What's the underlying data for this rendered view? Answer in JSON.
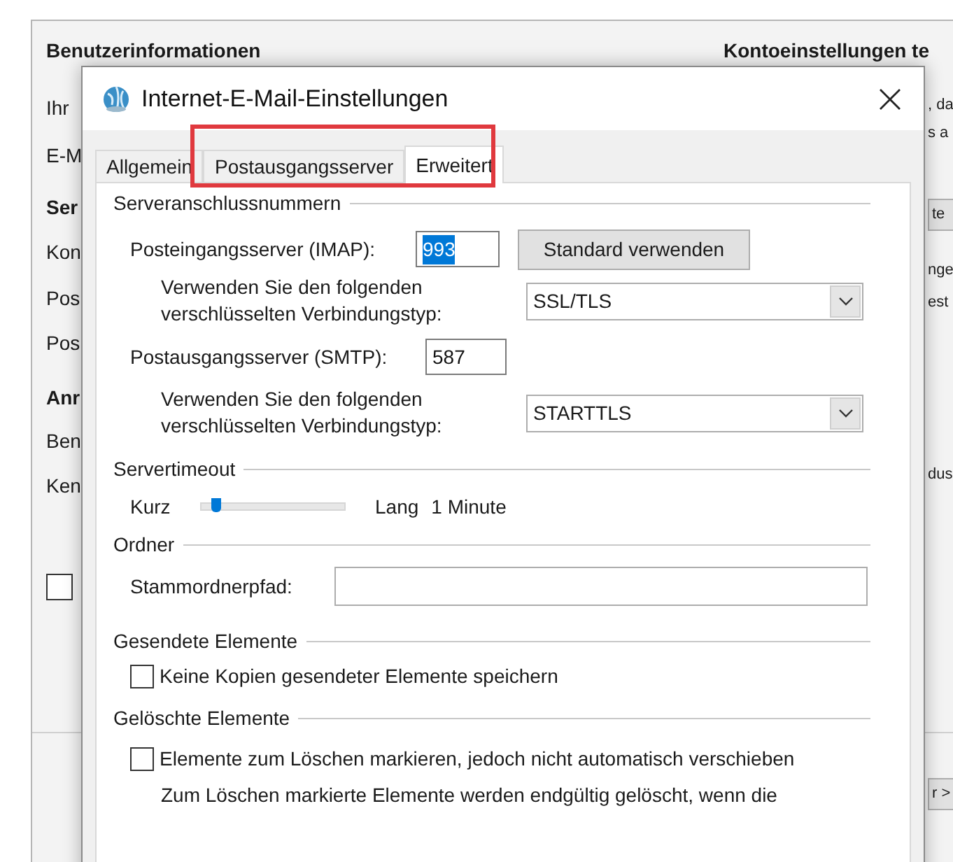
{
  "background_window": {
    "left_heading": "Benutzerinformationen",
    "right_heading": "Kontoeinstellungen te",
    "left_fragments": [
      {
        "text": "Ihr",
        "bold": false
      },
      {
        "text": "E-M",
        "bold": false
      },
      {
        "text": "Ser",
        "bold": true
      },
      {
        "text": "Kon",
        "bold": false
      },
      {
        "text": "Pos",
        "bold": false
      },
      {
        "text": "Pos",
        "bold": false
      },
      {
        "text": "Anr",
        "bold": true
      },
      {
        "text": "Ben",
        "bold": false
      },
      {
        "text": "Ken",
        "bold": false
      }
    ],
    "left_checkbox": {
      "checked": false
    },
    "right_fragments": [
      {
        "text": ", da",
        "kind": "text"
      },
      {
        "text": "s a",
        "kind": "text"
      },
      {
        "text": "te",
        "kind": "button"
      },
      {
        "text": "nge",
        "kind": "text"
      },
      {
        "text": "est",
        "kind": "text"
      },
      {
        "text": "dus",
        "kind": "text"
      },
      {
        "text": "r >",
        "kind": "button"
      }
    ]
  },
  "dialog": {
    "title": "Internet-E-Mail-Einstellungen",
    "tabs": [
      {
        "label": "Allgemein",
        "selected": false,
        "highlighted": false
      },
      {
        "label": "Postausgangsserver",
        "selected": false,
        "highlighted": true
      },
      {
        "label": "Erweitert",
        "selected": true,
        "highlighted": true
      }
    ],
    "server_ports": {
      "heading": "Serveranschlussnummern",
      "incoming": {
        "label": "Posteingangsserver (IMAP):",
        "value": "993",
        "value_selected": true,
        "button": "Standard verwenden"
      },
      "incoming_encryption": {
        "label": "Verwenden Sie den folgenden verschlüsselten Verbindungstyp:",
        "value": "SSL/TLS"
      },
      "outgoing": {
        "label": "Postausgangsserver (SMTP):",
        "value": "587",
        "value_selected": false
      },
      "outgoing_encryption": {
        "label": "Verwenden Sie den folgenden verschlüsselten Verbindungstyp:",
        "value": "STARTTLS"
      }
    },
    "server_timeout": {
      "heading": "Servertimeout",
      "min_label": "Kurz",
      "max_label": "Lang",
      "level": 0.1,
      "reading": "1 Minute"
    },
    "folders": {
      "heading": "Ordner",
      "label": "Stammordnerpfad:"
    },
    "sent_items": {
      "heading": "Gesendete Elemente",
      "checkbox": {
        "label": "Keine Kopien gesendeter Elemente speichern",
        "checked": false
      }
    },
    "deleted_items": {
      "heading": "Gelöschte Elemente",
      "checkbox": {
        "label": "Elemente zum Löschen markieren, jedoch nicht automatisch verschieben",
        "checked": false
      },
      "note": "Zum Löschen markierte Elemente werden endgültig gelöscht, wenn die"
    }
  }
}
